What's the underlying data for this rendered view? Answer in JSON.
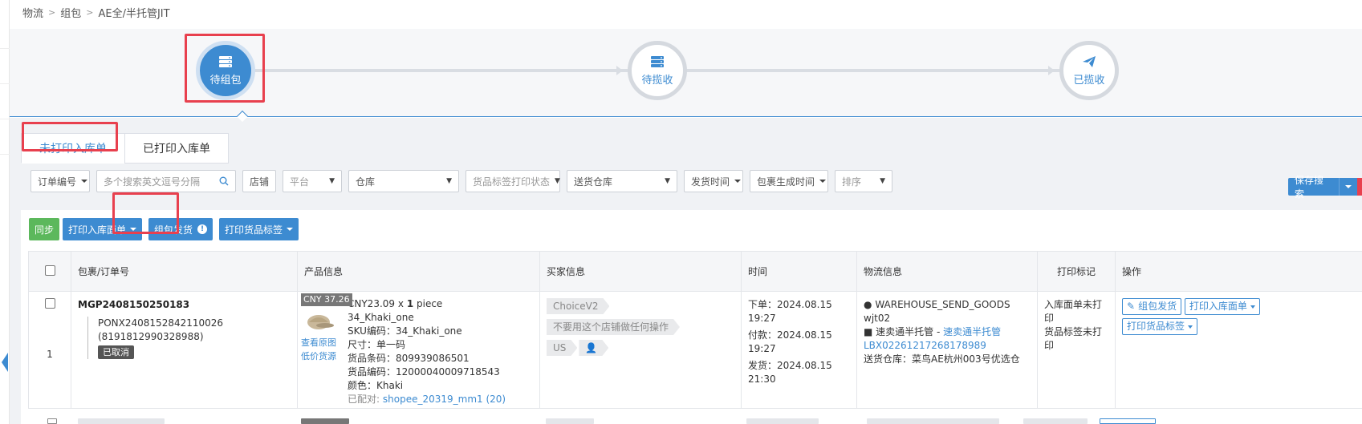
{
  "breadcrumb": [
    "物流",
    "组包",
    "AE全/半托管JIT"
  ],
  "steps": [
    {
      "label": "待组包",
      "icon": "server-stack-icon",
      "state": "active"
    },
    {
      "label": "待揽收",
      "icon": "server-stack-icon",
      "state": "inactive"
    },
    {
      "label": "已揽收",
      "icon": "paper-plane-icon",
      "state": "inactive"
    }
  ],
  "tabs": [
    {
      "label": "未打印入库单",
      "active": true
    },
    {
      "label": "已打印入库单",
      "active": false
    }
  ],
  "filters": {
    "order_no": "订单编号",
    "search_placeholder": "多个搜索英文逗号分隔",
    "shop": "店铺",
    "platform": "平台",
    "warehouse": "仓库",
    "label_print_status": "货品标签打印状态",
    "delivery_warehouse": "送货仓库",
    "ship_time": "发货时间",
    "package_time": "包裹生成时间",
    "sort": "排序",
    "save_search": "保存搜索"
  },
  "actions": {
    "sync": "同步",
    "print_inbound": "打印入库面单",
    "package_ship": "组包发货",
    "print_labels": "打印货品标签"
  },
  "table": {
    "headers": [
      "包裹/订单号",
      "产品信息",
      "买家信息",
      "时间",
      "物流信息",
      "打印标记",
      "操作"
    ],
    "rows": [
      {
        "index": "1",
        "package_no": "MGP2408150250183",
        "order_no": "PONX2408152842110026 (8191812990328988)",
        "status_tag": "已取消",
        "price_tag": "CNY 37.26",
        "unit_price": "CNY23.09",
        "qty_sep": "x",
        "qty": "1",
        "qty_unit": "piece",
        "sku_name": "34_Khaki_one",
        "sku_code": "SKU编码：34_Khaki_one",
        "size": "尺寸：单一码",
        "barcode": "货品条码：809939086501",
        "goods_code": "货品编码：12000040009718543",
        "color": "颜色：Khaki",
        "matched_label": "已配对:",
        "matched_value": "shopee_20319_mm1 (20)",
        "view_source": "查看原图",
        "low_price": "低价货源",
        "buyer_tags": [
          "ChoiceV2",
          "不要用这个店铺做任何操作"
        ],
        "country": "US",
        "time_order": "下单：2024.08.15 19:27",
        "time_paid": "付款：2024.08.15 19:27",
        "time_ship": "发货：2024.08.15 21:30",
        "logistics_line1": "WAREHOUSE_SEND_GOODS",
        "logistics_line2": "wjt02",
        "carrier": "速卖通半托管",
        "carrier_dash": " - ",
        "carrier_link": "速卖通半托管",
        "tracking_no": "LBX02261217268178989",
        "delivery_wh": "送货仓库：菜鸟AE杭州003号优选仓",
        "print_mark1": "入库面单未打印",
        "print_mark2": "货品标签未打印",
        "op_package": "组包发货",
        "op_print_inbound": "打印入库面单",
        "op_print_labels": "打印货品标签"
      }
    ]
  },
  "colors": {
    "accent": "#3d8bd1",
    "success": "#5cb85c",
    "highlight": "#e8404e"
  }
}
